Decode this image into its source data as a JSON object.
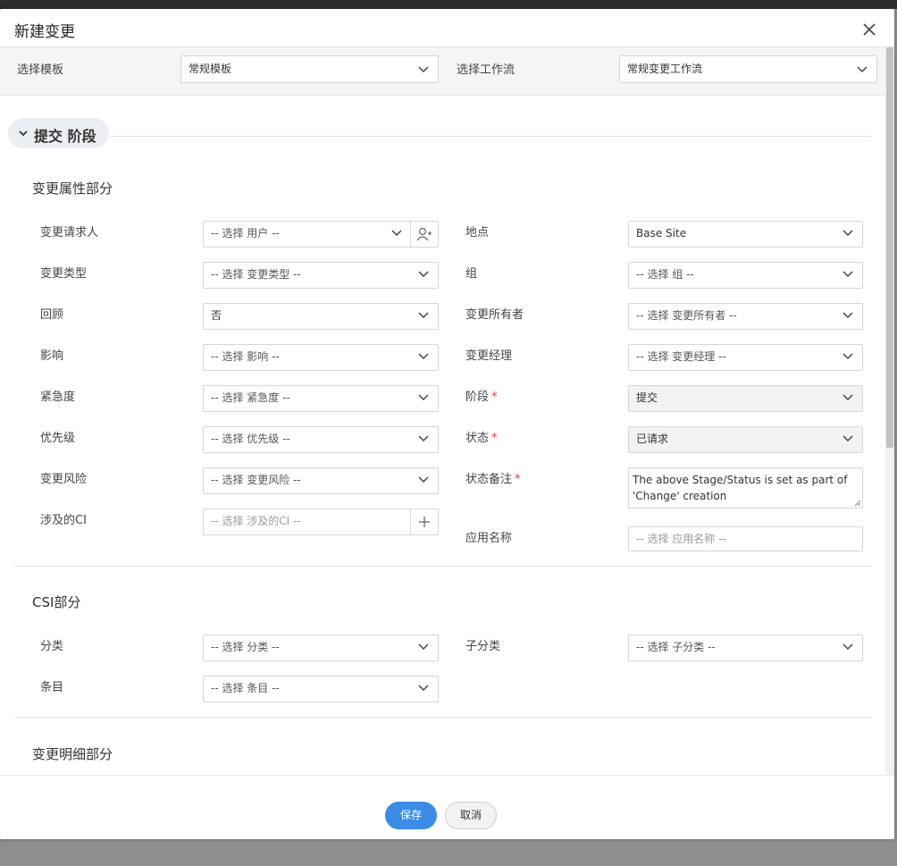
{
  "dialog": {
    "title": "新建变更"
  },
  "template_bar": {
    "template_label": "选择模板",
    "template_value": "常规模板",
    "workflow_label": "选择工作流",
    "workflow_value": "常规变更工作流"
  },
  "stage": {
    "label": "提交 阶段"
  },
  "sections": {
    "change_attributes": {
      "title": "变更属性部分",
      "left": [
        {
          "label": "变更请求人",
          "value": "-- 选择 用户 --"
        },
        {
          "label": "变更类型",
          "value": "-- 选择 变更类型 --"
        },
        {
          "label": "回顾",
          "value": "否"
        },
        {
          "label": "影响",
          "value": "-- 选择 影响 --"
        },
        {
          "label": "紧急度",
          "value": "-- 选择 紧急度 --"
        },
        {
          "label": "优先级",
          "value": "-- 选择 优先级 --"
        },
        {
          "label": "变更风险",
          "value": "-- 选择 变更风险 --"
        },
        {
          "label": "涉及的CI",
          "value": "-- 选择 涉及的CI --"
        }
      ],
      "right": [
        {
          "label": "地点",
          "value": "Base Site"
        },
        {
          "label": "组",
          "value": "-- 选择 组 --"
        },
        {
          "label": "变更所有者",
          "value": "-- 选择 变更所有者 --"
        },
        {
          "label": "变更经理",
          "value": "-- 选择 变更经理 --"
        },
        {
          "label": "阶段",
          "value": "提交",
          "required": "*"
        },
        {
          "label": "状态",
          "value": "已请求",
          "required": "*"
        },
        {
          "label": "状态备注",
          "value": "The above Stage/Status is set as part of 'Change' creation",
          "required": "*"
        },
        {
          "label": "应用名称",
          "value": "-- 选择 应用名称 --"
        }
      ]
    },
    "csi": {
      "title": "CSI部分",
      "category_label": "分类",
      "category_value": "-- 选择 分类 --",
      "subcategory_label": "子分类",
      "subcategory_value": "-- 选择 子分类 --",
      "item_label": "条目",
      "item_value": "-- 选择 条目 --"
    },
    "change_details": {
      "title": "变更明细部分"
    }
  },
  "footer": {
    "save_label": "保存",
    "cancel_label": "取消"
  },
  "colors": {
    "primary": "#3c8ce7",
    "required": "#e23b3b"
  }
}
